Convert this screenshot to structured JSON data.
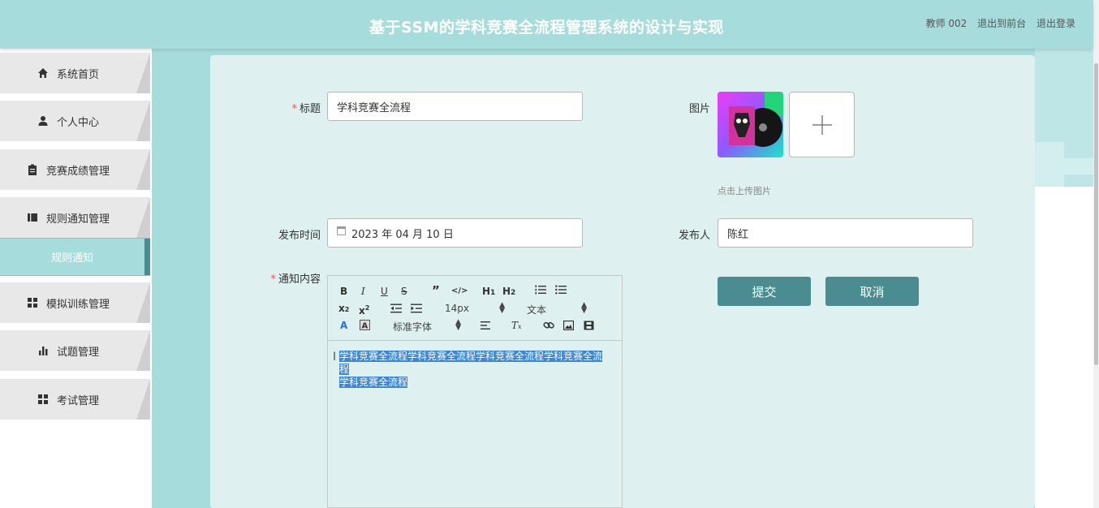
{
  "header": {
    "title": "基于SSM的学科竞赛全流程管理系统的设计与实现",
    "user": "教师 002",
    "link_front": "退出到前台",
    "link_logout": "退出登录"
  },
  "sidebar": {
    "items": [
      {
        "label": "系统首页",
        "icon": "home-icon"
      },
      {
        "label": "个人中心",
        "icon": "user-icon"
      },
      {
        "label": "竞赛成绩管理",
        "icon": "clipboard-icon"
      },
      {
        "label": "规则通知管理",
        "icon": "book-icon"
      },
      {
        "label": "模拟训练管理",
        "icon": "grid-icon"
      },
      {
        "label": "试题管理",
        "icon": "bar-chart-icon"
      },
      {
        "label": "考试管理",
        "icon": "grid-icon"
      }
    ],
    "active_sub": "规则通知"
  },
  "form": {
    "title_label": "标题",
    "title_value": "学科竞赛全流程",
    "image_label": "图片",
    "image_hint": "点击上传图片",
    "time_label": "发布时间",
    "time_value": "2023 年 04 月 10 日",
    "publisher_label": "发布人",
    "publisher_value": "陈红",
    "content_label": "通知内容",
    "submit": "提交",
    "cancel": "取消"
  },
  "editor": {
    "font_size": "14px",
    "text_type": "文本",
    "font_family": "标准字体",
    "content_line1": "学科竞赛全流程学科竞赛全流程学科竞赛全流程学科竞赛全流程",
    "content_line2": "学科竞赛全流程"
  },
  "colors": {
    "header_bg": "#a7dcdc",
    "accent": "#4a8c8f",
    "panel_bg": "#def0ef",
    "selection": "#3b86d6"
  }
}
